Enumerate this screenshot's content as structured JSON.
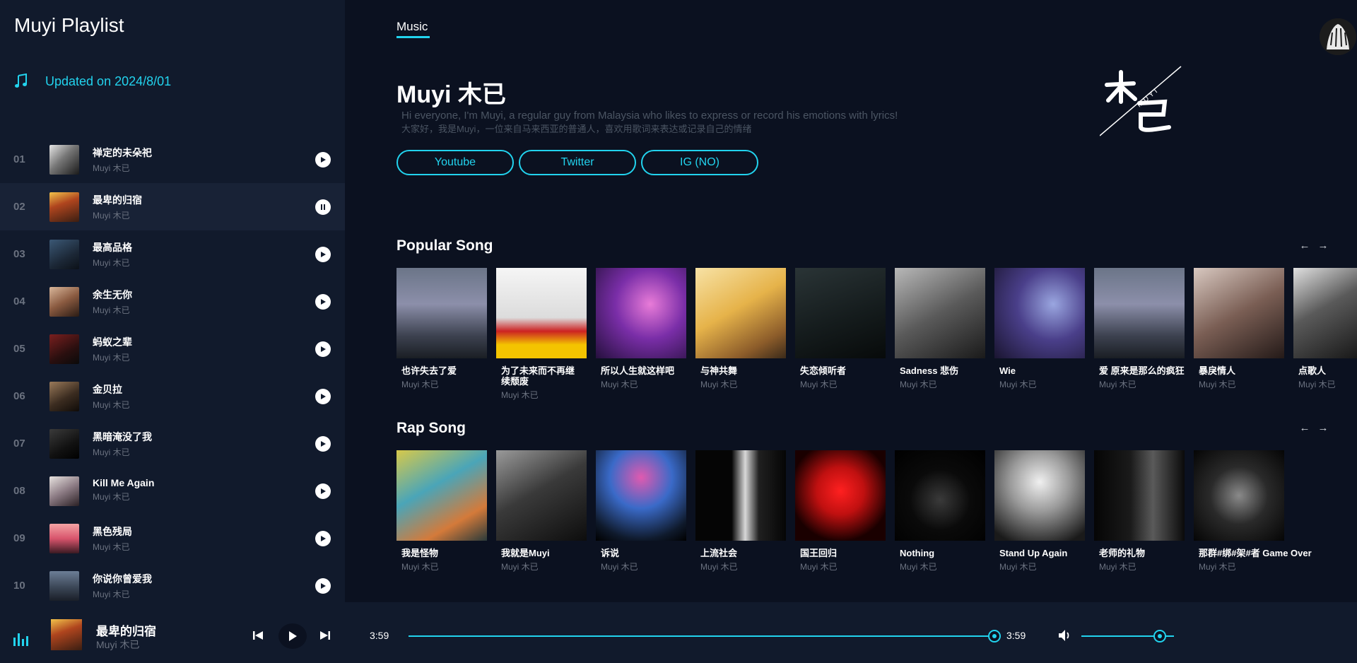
{
  "sidebar": {
    "title": "Muyi Playlist",
    "updated": "Updated on 2024/8/01",
    "tracks": [
      {
        "num": "01",
        "title": "禅定的未朵祀",
        "artist": "Muyi 木已",
        "state": "play"
      },
      {
        "num": "02",
        "title": "最卑的归宿",
        "artist": "Muyi 木已",
        "state": "pause"
      },
      {
        "num": "03",
        "title": "最高品格",
        "artist": "Muyi 木已",
        "state": "play"
      },
      {
        "num": "04",
        "title": "余生无你",
        "artist": "Muyi 木已",
        "state": "play"
      },
      {
        "num": "05",
        "title": "蚂蚁之辈",
        "artist": "Muyi 木已",
        "state": "play"
      },
      {
        "num": "06",
        "title": "金贝拉",
        "artist": "Muyi 木已",
        "state": "play"
      },
      {
        "num": "07",
        "title": "黑暗淹没了我",
        "artist": "Muyi 木已",
        "state": "play"
      },
      {
        "num": "08",
        "title": "Kill Me Again",
        "artist": "Muyi 木已",
        "state": "play"
      },
      {
        "num": "09",
        "title": "黑色残局",
        "artist": "Muyi 木已",
        "state": "play"
      },
      {
        "num": "10",
        "title": "你说你曾爱我",
        "artist": "Muyi 木已",
        "state": "play"
      }
    ]
  },
  "header": {
    "tab": "Music"
  },
  "artist": {
    "name": "Muyi 木已",
    "bio_en": "Hi everyone, I'm Muyi, a regular guy from Malaysia who likes to express or record his emotions with lyrics!",
    "bio_zh": "大家好，我是Muyi，一位来自马来西亚的普通人，喜欢用歌词来表达或记录自己的情绪",
    "links": [
      "Youtube",
      "Twitter",
      "IG (NO)"
    ]
  },
  "popular": {
    "title": "Popular Song",
    "songs": [
      {
        "title": "也许失去了爱",
        "artist": "Muyi 木已"
      },
      {
        "title": "为了未来而不再继续颓废",
        "artist": "Muyi 木已"
      },
      {
        "title": "所以人生就这样吧",
        "artist": "Muyi 木已"
      },
      {
        "title": "与神共舞",
        "artist": "Muyi 木已"
      },
      {
        "title": "失恋倾听者",
        "artist": "Muyi 木已"
      },
      {
        "title": "Sadness 悲伤",
        "artist": "Muyi 木已"
      },
      {
        "title": "Wie",
        "artist": "Muyi 木已"
      },
      {
        "title": "爱 原来是那么的疯狂",
        "artist": "Muyi 木已"
      },
      {
        "title": "暴戾情人",
        "artist": "Muyi 木已"
      },
      {
        "title": "点歌人",
        "artist": "Muyi 木已"
      }
    ]
  },
  "rap": {
    "title": "Rap Song",
    "songs": [
      {
        "title": "我是怪物",
        "artist": "Muyi 木已"
      },
      {
        "title": "我就是Muyi",
        "artist": "Muyi 木已"
      },
      {
        "title": "诉说",
        "artist": "Muyi 木已"
      },
      {
        "title": "上流社会",
        "artist": "Muyi 木已"
      },
      {
        "title": "国王回归",
        "artist": "Muyi 木已"
      },
      {
        "title": "Nothing",
        "artist": "Muyi 木已"
      },
      {
        "title": "Stand Up Again",
        "artist": "Muyi 木已"
      },
      {
        "title": "老师的礼物",
        "artist": "Muyi 木已"
      },
      {
        "title": "那群#绑#架#者 Game Over",
        "artist": "Muyi 木已"
      }
    ]
  },
  "player": {
    "title": "最卑的归宿",
    "artist": "Muyi 木已",
    "time_current": "3:59",
    "time_total": "3:59",
    "progress": 1.0,
    "volume": 0.85
  },
  "colors": {
    "accent": "#22d3ee",
    "bg": "#0b1120",
    "panel": "#111a2c"
  }
}
